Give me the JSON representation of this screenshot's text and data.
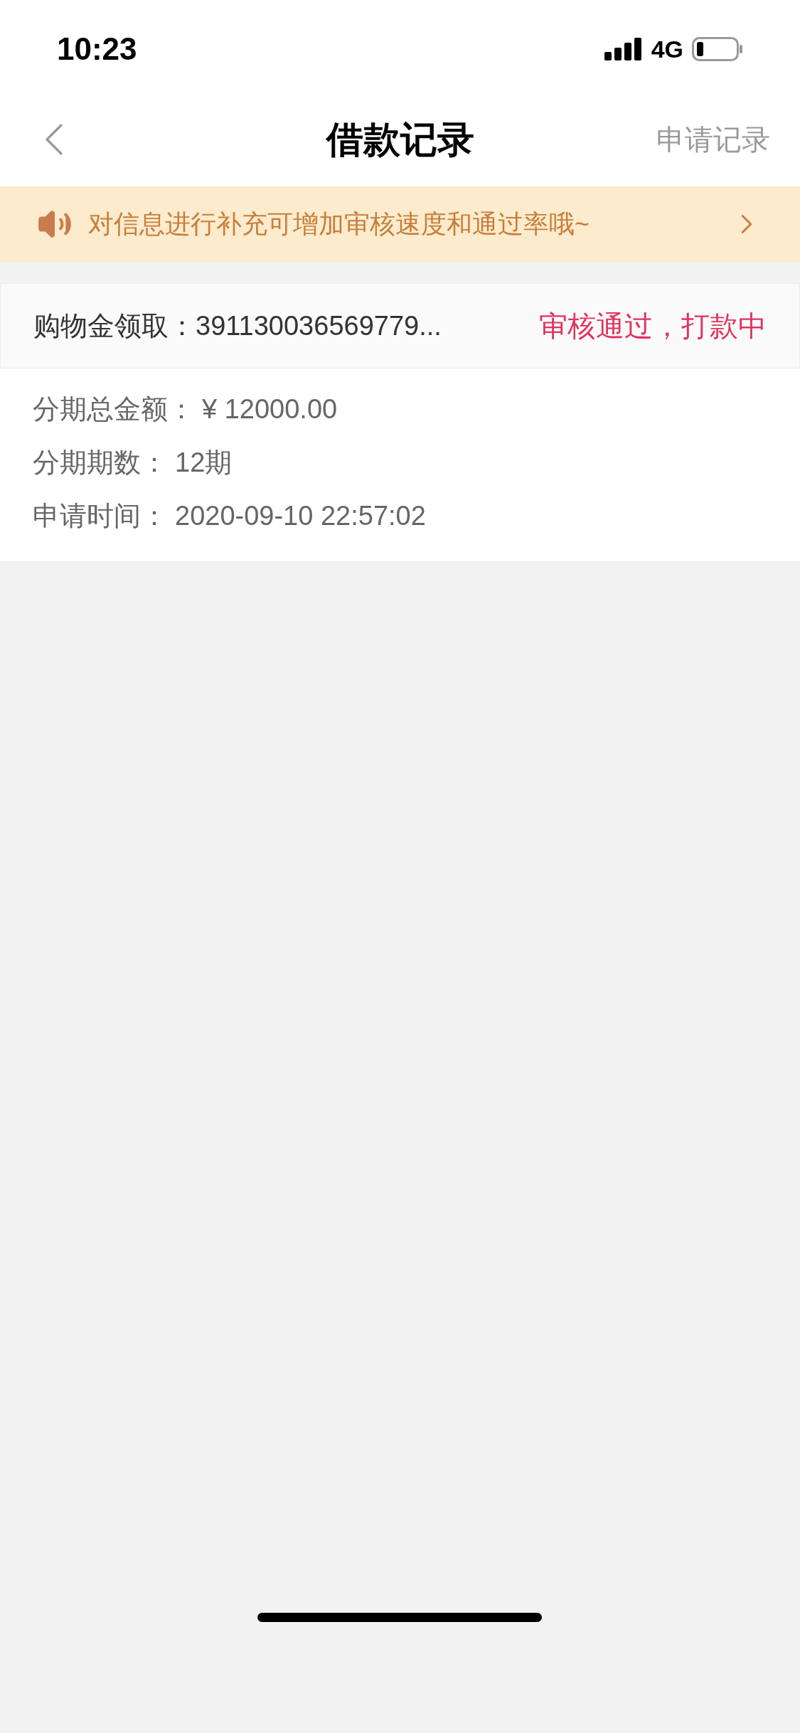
{
  "status_bar": {
    "time": "10:23",
    "network": "4G"
  },
  "nav": {
    "title": "借款记录",
    "action": "申请记录"
  },
  "notice": {
    "text": "对信息进行补充可增加审核速度和通过率哦~"
  },
  "records": [
    {
      "title": "购物金领取：391130036569779...",
      "status": "审核通过，打款中",
      "details": [
        {
          "label": "分期总金额：",
          "value": "¥ 12000.00"
        },
        {
          "label": "分期期数：",
          "value": "12期"
        },
        {
          "label": "申请时间：",
          "value": "2020-09-10 22:57:02"
        }
      ]
    }
  ]
}
